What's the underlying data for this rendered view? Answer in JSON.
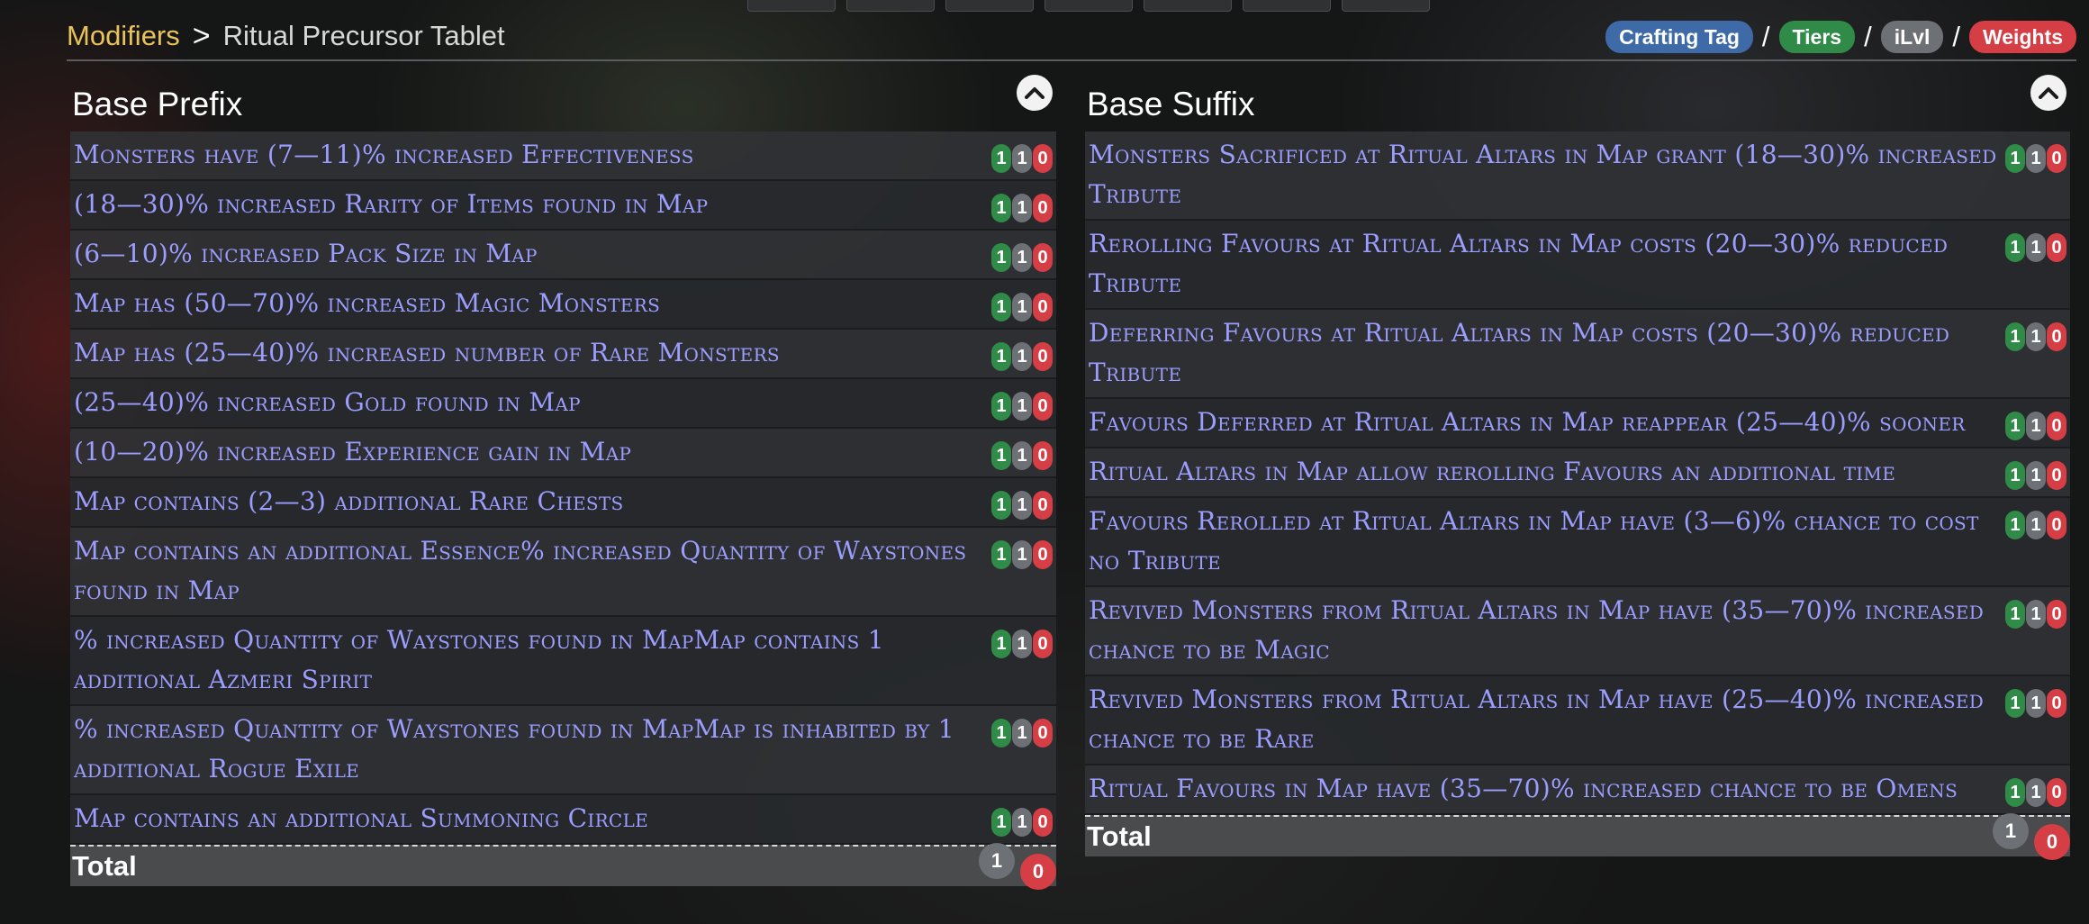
{
  "header": {
    "breadcrumb_root": "Modifiers",
    "breadcrumb_separator": ">",
    "breadcrumb_current": "Ritual Precursor Tablet",
    "legend": {
      "crafting_tag": "Crafting Tag",
      "tiers": "Tiers",
      "ilvl": "iLvl",
      "weights": "Weights",
      "separator": "/"
    }
  },
  "colors": {
    "tiers": "#2f8b47",
    "ilvl": "#6d7075",
    "weights": "#d63e46",
    "crafting_tag": "#3f6aa8",
    "mod_text": "#9b9dff",
    "breadcrumb_root": "#e8c25a"
  },
  "prefix": {
    "title": "Base Prefix",
    "mods": [
      {
        "text": "Monsters have (7—11)% increased Effectiveness",
        "tier": "1",
        "ilvl": "1",
        "weight": "0"
      },
      {
        "text": "(18—30)% increased Rarity of Items found in Map",
        "tier": "1",
        "ilvl": "1",
        "weight": "0"
      },
      {
        "text": "(6—10)% increased Pack Size in Map",
        "tier": "1",
        "ilvl": "1",
        "weight": "0"
      },
      {
        "text": "Map has (50—70)% increased Magic Monsters",
        "tier": "1",
        "ilvl": "1",
        "weight": "0"
      },
      {
        "text": "Map has (25—40)% increased number of Rare Monsters",
        "tier": "1",
        "ilvl": "1",
        "weight": "0"
      },
      {
        "text": "(25—40)% increased Gold found in Map",
        "tier": "1",
        "ilvl": "1",
        "weight": "0"
      },
      {
        "text": "(10—20)% increased Experience gain in Map",
        "tier": "1",
        "ilvl": "1",
        "weight": "0"
      },
      {
        "text": "Map contains (2—3) additional Rare Chests",
        "tier": "1",
        "ilvl": "1",
        "weight": "0"
      },
      {
        "text": "Map contains an additional Essence% increased Quantity of Waystones found in Map",
        "tier": "1",
        "ilvl": "1",
        "weight": "0"
      },
      {
        "text": "% increased Quantity of Waystones found in MapMap contains 1 additional Azmeri Spirit",
        "tier": "1",
        "ilvl": "1",
        "weight": "0"
      },
      {
        "text": "% increased Quantity of Waystones found in MapMap is inhabited by 1 additional Rogue Exile",
        "tier": "1",
        "ilvl": "1",
        "weight": "0"
      },
      {
        "text": "Map contains an additional Summoning Circle",
        "tier": "1",
        "ilvl": "1",
        "weight": "0"
      }
    ],
    "total_label": "Total",
    "total_ilvl": "1",
    "total_weight": "0"
  },
  "suffix": {
    "title": "Base Suffix",
    "mods": [
      {
        "text": "Monsters Sacrificed at Ritual Altars in Map grant (18—30)% increased Tribute",
        "tier": "1",
        "ilvl": "1",
        "weight": "0"
      },
      {
        "text": "Rerolling Favours at Ritual Altars in Map costs (20—30)% reduced Tribute",
        "tier": "1",
        "ilvl": "1",
        "weight": "0"
      },
      {
        "text": "Deferring Favours at Ritual Altars in Map costs (20—30)% reduced Tribute",
        "tier": "1",
        "ilvl": "1",
        "weight": "0"
      },
      {
        "text": "Favours Deferred at Ritual Altars in Map reappear (25—40)% sooner",
        "tier": "1",
        "ilvl": "1",
        "weight": "0"
      },
      {
        "text": "Ritual Altars in Map allow rerolling Favours an additional time",
        "tier": "1",
        "ilvl": "1",
        "weight": "0"
      },
      {
        "text": "Favours Rerolled at Ritual Altars in Map have (3—6)% chance to cost no Tribute",
        "tier": "1",
        "ilvl": "1",
        "weight": "0"
      },
      {
        "text": "Revived Monsters from Ritual Altars in Map have (35—70)% increased chance to be Magic",
        "tier": "1",
        "ilvl": "1",
        "weight": "0"
      },
      {
        "text": "Revived Monsters from Ritual Altars in Map have (25—40)% increased chance to be Rare",
        "tier": "1",
        "ilvl": "1",
        "weight": "0"
      },
      {
        "text": "Ritual Favours in Map have (35—70)% increased chance to be Omens",
        "tier": "1",
        "ilvl": "1",
        "weight": "0"
      }
    ],
    "total_label": "Total",
    "total_ilvl": "1",
    "total_weight": "0"
  }
}
